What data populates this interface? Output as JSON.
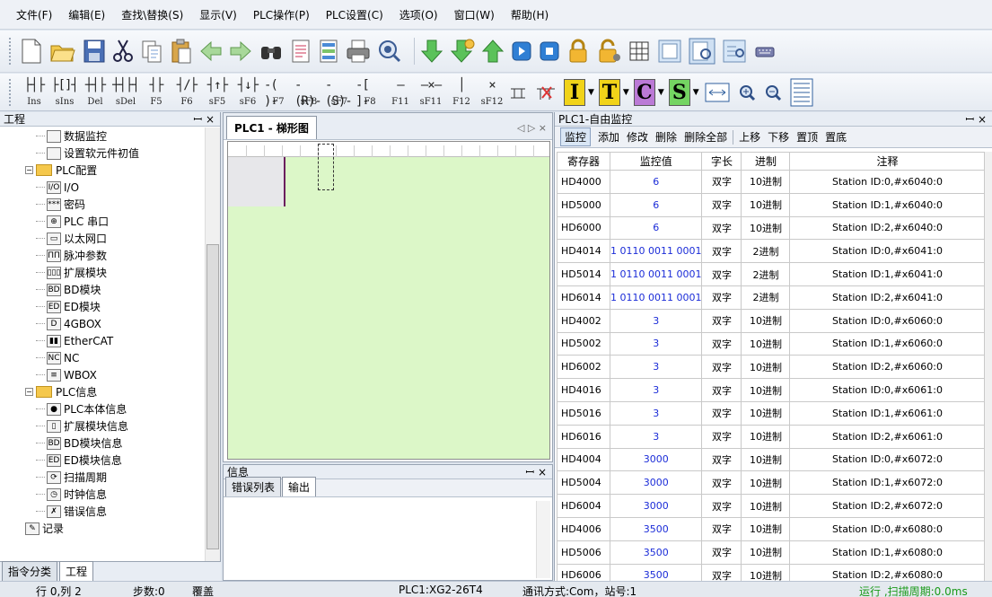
{
  "menu": [
    "文件(F)",
    "编辑(E)",
    "查找\\替换(S)",
    "显示(V)",
    "PLC操作(P)",
    "PLC设置(C)",
    "选项(O)",
    "窗口(W)",
    "帮助(H)"
  ],
  "ladder_keys": [
    {
      "glyph": "├┤├",
      "key": "Ins"
    },
    {
      "glyph": "├[]┤",
      "key": "sIns"
    },
    {
      "glyph": "┼┤├",
      "key": "Del"
    },
    {
      "glyph": "┼┤├┤",
      "key": "sDel"
    },
    {
      "glyph": "┤├",
      "key": "F5"
    },
    {
      "glyph": "┤/├",
      "key": "F6"
    },
    {
      "glyph": "┤↑├",
      "key": "sF5"
    },
    {
      "glyph": "┤↓├",
      "key": "sF6"
    },
    {
      "glyph": "-( )-",
      "key": "F7"
    },
    {
      "glyph": "-(R)-",
      "key": "sF8"
    },
    {
      "glyph": "-(S)-",
      "key": "sF7"
    },
    {
      "glyph": "-[ ]-",
      "key": "F8"
    },
    {
      "glyph": "—",
      "key": "F11"
    },
    {
      "glyph": "—×—",
      "key": "sF11"
    },
    {
      "glyph": "│",
      "key": "F12"
    },
    {
      "glyph": "×",
      "key": "sF12"
    }
  ],
  "letter_buttons": [
    {
      "text": "I",
      "bg": "#f1d319"
    },
    {
      "text": "T",
      "bg": "#f1d319"
    },
    {
      "text": "C",
      "bg": "#bb7ad6"
    },
    {
      "text": "S",
      "bg": "#74d462"
    }
  ],
  "left_panel": {
    "title": "工程",
    "pin": "ꟷ ×",
    "tabs": [
      "指令分类",
      "工程"
    ],
    "tree": [
      {
        "label": "数据监控",
        "level": 2,
        "icon": "data-monitor"
      },
      {
        "label": "设置软元件初值",
        "level": 2,
        "icon": "init-value"
      },
      {
        "label": "PLC配置",
        "level": 1,
        "icon": "folder",
        "expand": "−"
      },
      {
        "label": "I/O",
        "level": 2,
        "icon": "io",
        "badge": "I/O"
      },
      {
        "label": "密码",
        "level": 2,
        "icon": "password",
        "badge": "***"
      },
      {
        "label": "PLC 串口",
        "level": 2,
        "icon": "serial-port",
        "badge": "⊕"
      },
      {
        "label": "以太网口",
        "level": 2,
        "icon": "ethernet",
        "badge": "▭"
      },
      {
        "label": "脉冲参数",
        "level": 2,
        "icon": "pulse",
        "badge": "ΠΠ"
      },
      {
        "label": "扩展模块",
        "level": 2,
        "icon": "extension",
        "badge": "▯▯▯"
      },
      {
        "label": "BD模块",
        "level": 2,
        "icon": "bd-module",
        "badge": "BD"
      },
      {
        "label": "ED模块",
        "level": 2,
        "icon": "ed-module",
        "badge": "ED"
      },
      {
        "label": "4GBOX",
        "level": 2,
        "icon": "4gbox",
        "badge": "D"
      },
      {
        "label": "EtherCAT",
        "level": 2,
        "icon": "ethercat",
        "badge": "▮▮"
      },
      {
        "label": "NC",
        "level": 2,
        "icon": "nc",
        "badge": "NC"
      },
      {
        "label": "WBOX",
        "level": 2,
        "icon": "wbox",
        "badge": "≡"
      },
      {
        "label": "PLC信息",
        "level": 1,
        "icon": "folder",
        "expand": "−"
      },
      {
        "label": "PLC本体信息",
        "level": 2,
        "icon": "plc-info",
        "badge": "●"
      },
      {
        "label": "扩展模块信息",
        "level": 2,
        "icon": "ext-info",
        "badge": "▯"
      },
      {
        "label": "BD模块信息",
        "level": 2,
        "icon": "bd-info",
        "badge": "BD"
      },
      {
        "label": "ED模块信息",
        "level": 2,
        "icon": "ed-info",
        "badge": "ED"
      },
      {
        "label": "扫描周期",
        "level": 2,
        "icon": "scan-cycle",
        "badge": "⟳"
      },
      {
        "label": "时钟信息",
        "level": 2,
        "icon": "clock",
        "badge": "◷"
      },
      {
        "label": "错误信息",
        "level": 2,
        "icon": "error",
        "badge": "✗"
      },
      {
        "label": "记录",
        "level": 1,
        "icon": "record",
        "badge": "✎"
      }
    ]
  },
  "ladder": {
    "tab_label": "PLC1 - 梯形图",
    "tab_controls": "◁ ▷ ×"
  },
  "info": {
    "title": "信息",
    "pin": "ꟷ ×",
    "tabs": [
      "错误列表",
      "输出"
    ]
  },
  "monitor": {
    "title": "PLC1-自由监控",
    "pin": "ꟷ ×",
    "toolbar": [
      "监控",
      "添加",
      "修改",
      "删除",
      "删除全部",
      "上移",
      "下移",
      "置顶",
      "置底"
    ],
    "columns": [
      "寄存器",
      "监控值",
      "字长",
      "进制",
      "注释"
    ],
    "rows": [
      [
        "HD4000",
        "6",
        "双字",
        "10进制",
        "Station ID:0,#x6040:0"
      ],
      [
        "HD5000",
        "6",
        "双字",
        "10进制",
        "Station ID:1,#x6040:0"
      ],
      [
        "HD6000",
        "6",
        "双字",
        "10进制",
        "Station ID:2,#x6040:0"
      ],
      [
        "HD4014",
        "1 0110 0011 0001",
        "双字",
        "2进制",
        "Station ID:0,#x6041:0"
      ],
      [
        "HD5014",
        "1 0110 0011 0001",
        "双字",
        "2进制",
        "Station ID:1,#x6041:0"
      ],
      [
        "HD6014",
        "1 0110 0011 0001",
        "双字",
        "2进制",
        "Station ID:2,#x6041:0"
      ],
      [
        "HD4002",
        "3",
        "双字",
        "10进制",
        "Station ID:0,#x6060:0"
      ],
      [
        "HD5002",
        "3",
        "双字",
        "10进制",
        "Station ID:1,#x6060:0"
      ],
      [
        "HD6002",
        "3",
        "双字",
        "10进制",
        "Station ID:2,#x6060:0"
      ],
      [
        "HD4016",
        "3",
        "双字",
        "10进制",
        "Station ID:0,#x6061:0"
      ],
      [
        "HD5016",
        "3",
        "双字",
        "10进制",
        "Station ID:1,#x6061:0"
      ],
      [
        "HD6016",
        "3",
        "双字",
        "10进制",
        "Station ID:2,#x6061:0"
      ],
      [
        "HD4004",
        "3000",
        "双字",
        "10进制",
        "Station ID:0,#x6072:0"
      ],
      [
        "HD5004",
        "3000",
        "双字",
        "10进制",
        "Station ID:1,#x6072:0"
      ],
      [
        "HD6004",
        "3000",
        "双字",
        "10进制",
        "Station ID:2,#x6072:0"
      ],
      [
        "HD4006",
        "3500",
        "双字",
        "10进制",
        "Station ID:0,#x6080:0"
      ],
      [
        "HD5006",
        "3500",
        "双字",
        "10进制",
        "Station ID:1,#x6080:0"
      ],
      [
        "HD6006",
        "3500",
        "双字",
        "10进制",
        "Station ID:2,#x6080:0"
      ]
    ]
  },
  "status": {
    "position": "行 0,列 2",
    "steps": "步数:0",
    "mode": "覆盖",
    "model": "PLC1:XG2-26T4",
    "comm": "通讯方式:Com，站号:1",
    "run": "运行 ,扫描周期:0.0ms"
  },
  "colors": {
    "ladder_bg": "#dcf7c8",
    "value_text": "#1b2cd8",
    "run_status": "#1a9a1a"
  }
}
